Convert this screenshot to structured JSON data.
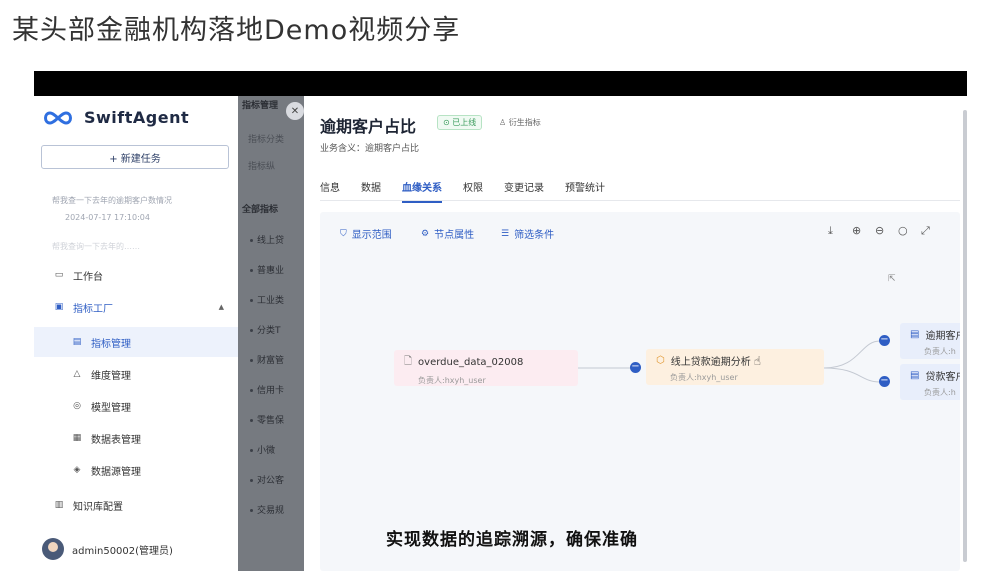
{
  "video_title": "某头部金融机构落地Demo视频分享",
  "subtitle": "实现数据的追踪溯源，确保准确",
  "app": {
    "brand": "SwiftAgent"
  },
  "sidebar": {
    "new_task": "+ 新建任务",
    "history": [
      {
        "title": "帮我查一下去年的逾期客户数情况",
        "time": "2024-07-17 17:10:04"
      },
      {
        "title": "帮我查询一下去年的……",
        "time": ""
      }
    ],
    "nav": [
      {
        "label": "工作台",
        "icon": "monitor-icon"
      },
      {
        "label": "指标工厂",
        "icon": "chart-icon"
      },
      {
        "label": "指标管理",
        "icon": "doc-icon"
      },
      {
        "label": "维度管理",
        "icon": "triangle-icon"
      },
      {
        "label": "模型管理",
        "icon": "circle-icon"
      },
      {
        "label": "数据表管理",
        "icon": "table-icon"
      },
      {
        "label": "数据源管理",
        "icon": "layers-icon"
      },
      {
        "label": "知识库配置",
        "icon": "book-icon"
      }
    ],
    "user": "admin50002(管理员)"
  },
  "background_page": {
    "items": [
      "指标管理",
      "指标分类",
      "指标纵",
      "全部指标",
      "线上贷",
      "普惠业",
      "工业类",
      "分类T",
      "财富管",
      "信用卡",
      "零售保",
      "小微",
      "对公客",
      "交易规"
    ]
  },
  "drawer": {
    "title": "逾期客户占比",
    "status_badge": "⊙ 已上线",
    "type_badge": "♙ 衍生指标",
    "meta": "业务含义：逾期客户占比",
    "tabs": [
      "信息",
      "数据",
      "血缘关系",
      "权限",
      "变更记录",
      "预警统计"
    ],
    "active_tab": "血缘关系",
    "toolbar": {
      "scope": "显示范围",
      "node_attr": "节点属性",
      "filter": "筛选条件"
    },
    "lineage": {
      "source": {
        "name": "overdue_data_02008",
        "owner": "负责人:hxyh_user"
      },
      "analysis": {
        "name": "线上贷款逾期分析",
        "owner": "负责人:hxyh_user"
      },
      "outputs": [
        {
          "name": "逾期客户",
          "owner": "负责人:h"
        },
        {
          "name": "贷款客户",
          "owner": "负责人:h"
        }
      ]
    }
  },
  "colors": {
    "accent": "#2f5ec4",
    "online": "#3a9c5c"
  }
}
